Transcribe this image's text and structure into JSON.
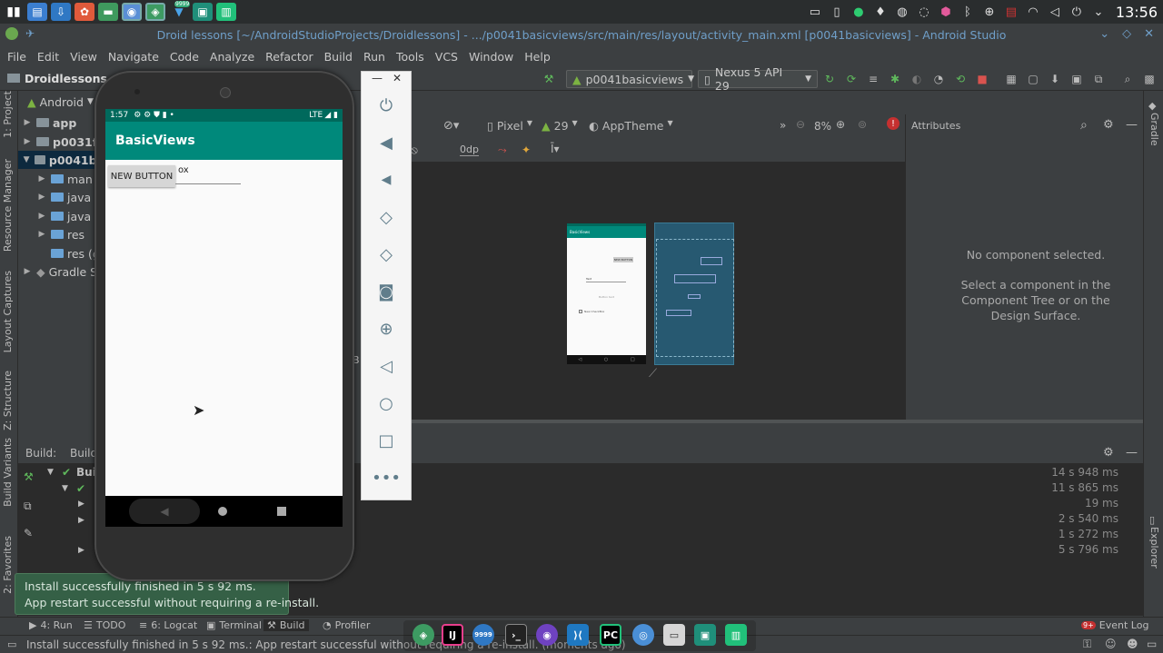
{
  "taskbar": {
    "apps": [
      "app-menu",
      "files",
      "download",
      "photos",
      "folder",
      "chromium",
      "android-studio",
      "updates",
      "screen-capture",
      "pycharm-green"
    ],
    "badge_updates": "9999",
    "clock": "13:56"
  },
  "window": {
    "title": "Droid lessons [~/AndroidStudioProjects/Droidlessons] - .../p0041basicviews/src/main/res/layout/activity_main.xml [p0041basicviews] - Android Studio"
  },
  "menu": [
    "File",
    "Edit",
    "View",
    "Navigate",
    "Code",
    "Analyze",
    "Refactor",
    "Build",
    "Run",
    "Tools",
    "VCS",
    "Window",
    "Help"
  ],
  "toolbar": {
    "breadcrumb": "Droidlessons",
    "run_config": "p0041basicviews",
    "device": "Nexus 5 API 29"
  },
  "left_tabs": {
    "project": "1: Project",
    "resource_manager": "Resource Manager",
    "layout_captures": "Layout Captures",
    "structure": "Z: Structure",
    "build_variants": "Build Variants",
    "favorites": "2: Favorites"
  },
  "project": {
    "view_mode": "Android",
    "tree": [
      {
        "label": "app"
      },
      {
        "label": "p0031fir"
      },
      {
        "label": "p0041ba"
      },
      {
        "label": "man"
      },
      {
        "label": "java"
      },
      {
        "label": "java ("
      },
      {
        "label": "res"
      },
      {
        "label": "res (g"
      },
      {
        "label": "Gradle S"
      }
    ]
  },
  "design": {
    "device": "Pixel",
    "api": "29",
    "theme": "AppTheme",
    "zoom": "8%",
    "margin": "0dp"
  },
  "attributes": {
    "title": "Attributes",
    "empty_title": "No component selected.",
    "empty_hint": "Select a component in the Component Tree or on the Design Surface."
  },
  "right_tabs": {
    "gradle": "Gradle",
    "device_explorer": "Device File Explorer"
  },
  "build": {
    "tab1": "Build:",
    "tab2": "Build",
    "root_label": "Bui",
    "times": [
      "14 s 948 ms",
      "11 s 865 ms",
      "19 ms",
      "2 s 540 ms",
      "1 s 272 ms",
      "5 s 796 ms"
    ]
  },
  "emulator": {
    "time": "1:57",
    "network": "LTE",
    "app_title": "BasicViews",
    "button": "NEW BUTTON",
    "checkbox_fragment": "ox"
  },
  "mini_preview": {
    "app_title": "BasicViews",
    "button": "NEW BUTTON",
    "text_field": "Text",
    "hint": "Button text",
    "checkbox": "New CheckBox"
  },
  "notification": {
    "line1": "Install successfully finished in 5 s 92 ms.",
    "line2": "App restart successful without requiring a re-install."
  },
  "bottom_tabs": {
    "run": "4: Run",
    "todo": "TODO",
    "logcat": "6: Logcat",
    "terminal": "Terminal",
    "build": "Build",
    "profiler": "Profiler",
    "event_log": "Event Log",
    "event_count": "9+"
  },
  "status": {
    "message": "Install successfully finished in 5 s 92 ms.: App restart successful without requiring a re-install. (moments ago)"
  },
  "dock": {
    "apps": [
      "android-studio",
      "intellij",
      "updates",
      "terminal",
      "media",
      "vscode",
      "pycharm",
      "chromium",
      "files",
      "screen-capture",
      "pycharm-green"
    ],
    "badge": "9999"
  },
  "colors": {
    "ide_bg": "#3c3f41",
    "editor_bg": "#2b2b2b",
    "accent_teal": "#00897b",
    "selection": "#0d293e",
    "balloon": "#356046"
  }
}
